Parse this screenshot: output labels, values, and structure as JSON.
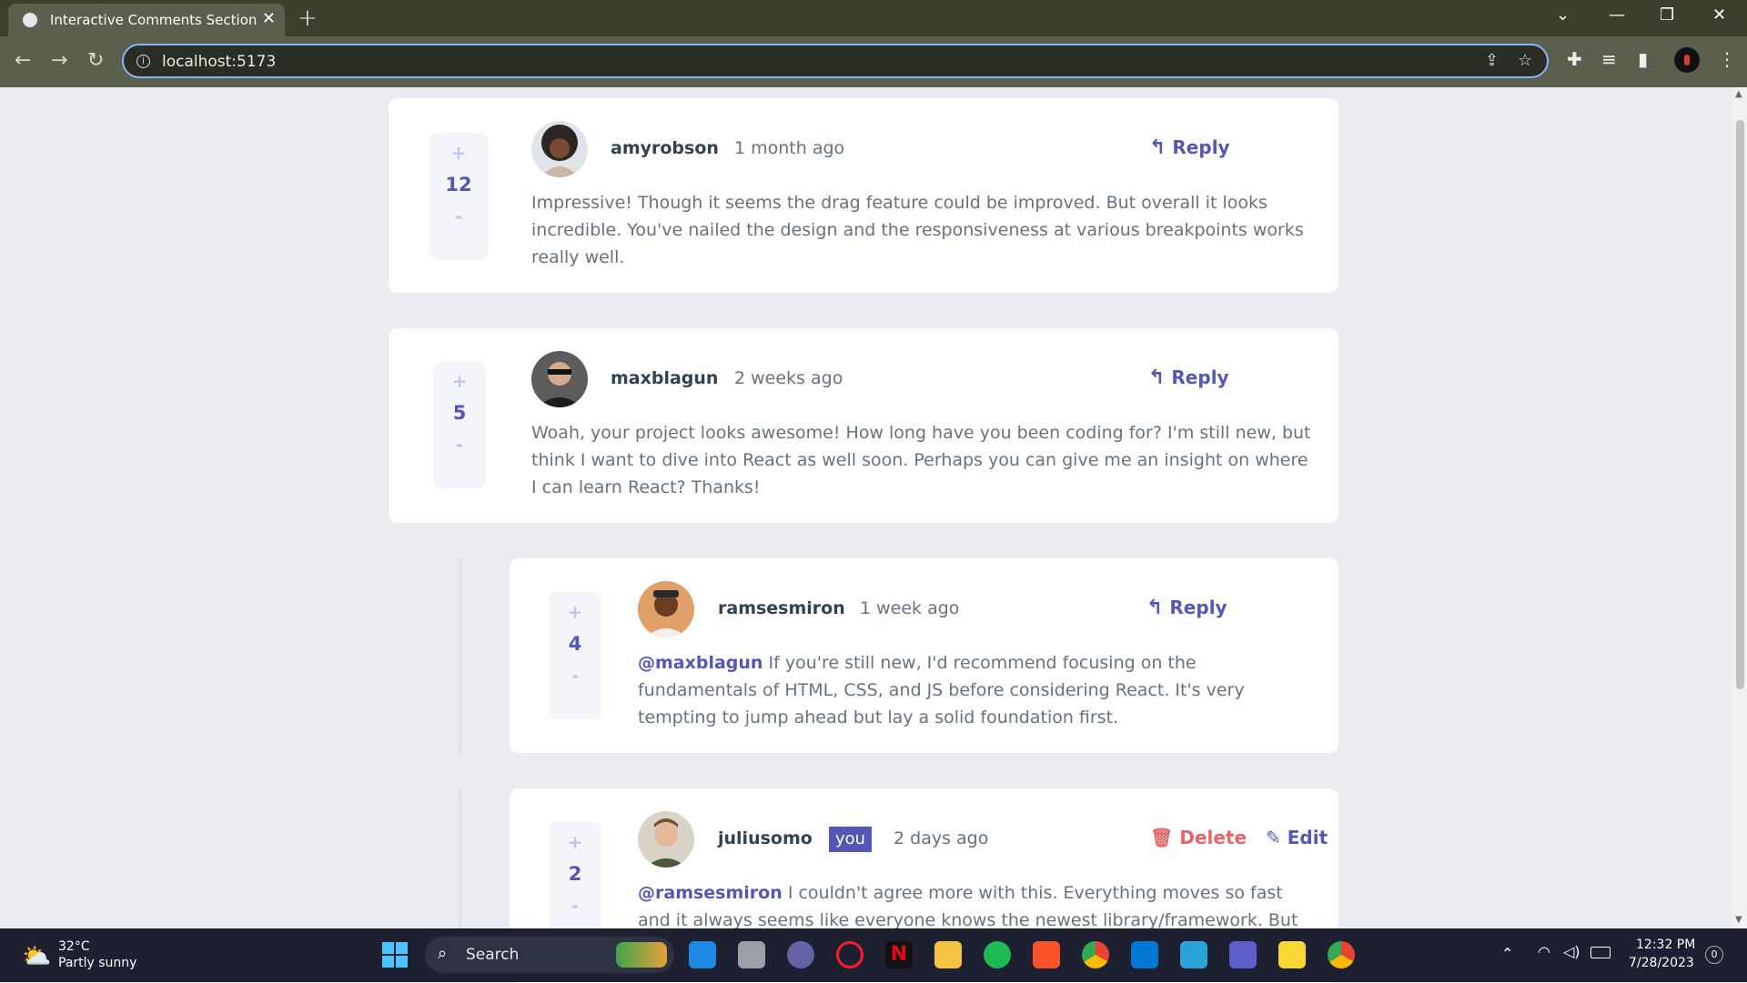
{
  "browser": {
    "tab_title": "Interactive Comments Section",
    "url": "localhost:5173"
  },
  "comments": [
    {
      "username": "amyrobson",
      "time": "1 month ago",
      "score": "12",
      "reply_label": "Reply",
      "body": "Impressive! Though it seems the drag feature could be improved. But overall it looks incredible. You've nailed the design and the responsiveness at various breakpoints works really well."
    },
    {
      "username": "maxblagun",
      "time": "2 weeks ago",
      "score": "5",
      "reply_label": "Reply",
      "body": "Woah, your project looks awesome! How long have you been coding for? I'm still new, but think I want to dive into React as well soon. Perhaps you can give me an insight on where I can learn React? Thanks!"
    },
    {
      "username": "ramsesmiron",
      "time": "1 week ago",
      "score": "4",
      "reply_label": "Reply",
      "mention": "@maxblagun",
      "body": "If you're still new, I'd recommend focusing on the fundamentals of HTML, CSS, and JS before considering React. It's very tempting to jump ahead but lay a solid foundation first."
    },
    {
      "username": "juliusomo",
      "you_badge": "you",
      "time": "2 days ago",
      "score": "2",
      "delete_label": "Delete",
      "edit_label": "Edit",
      "mention": "@ramsesmiron",
      "body": "I couldn't agree more with this. Everything moves so fast and it always seems like everyone knows the newest library/framework. But the"
    }
  ],
  "vote": {
    "plus": "+",
    "minus": "-"
  },
  "taskbar": {
    "weather_temp": "32°C",
    "weather_desc": "Partly sunny",
    "search_label": "Search",
    "time": "12:32 PM",
    "date": "7/28/2023",
    "notification_count": "0"
  },
  "colors": {
    "accent": "#5457b6",
    "delete": "#ed6468",
    "text": "#67727e",
    "heading": "#334253",
    "page_bg": "#eaecf1"
  }
}
